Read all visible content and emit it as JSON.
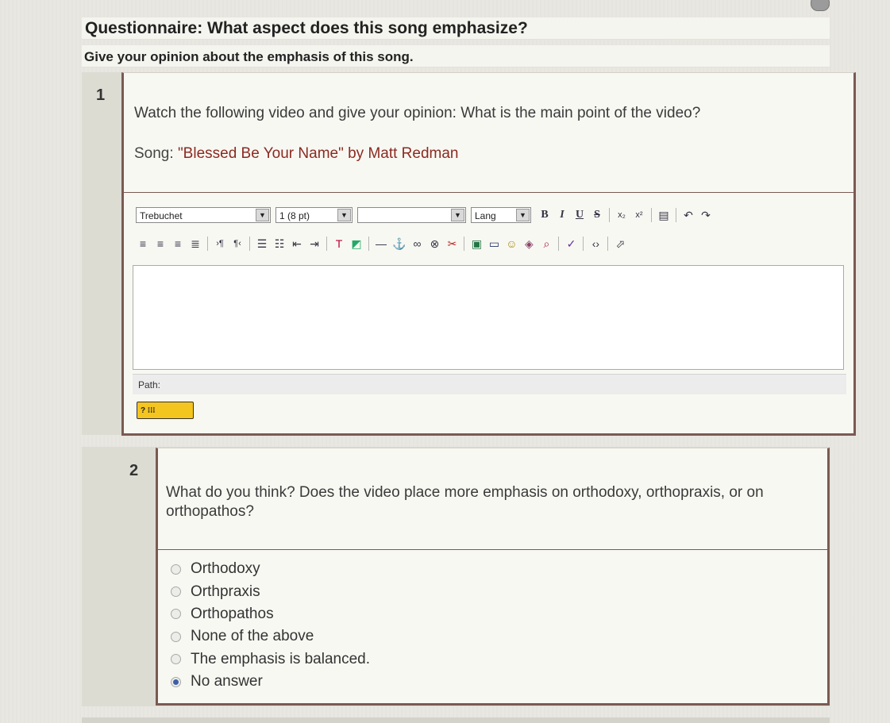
{
  "questionnaire": {
    "title": "Questionnaire: What aspect does this song emphasize?",
    "subtitle": "Give your opinion about the emphasis of this song."
  },
  "q1": {
    "number": "1",
    "text": "Watch the following video and give your opinion: What is the main point of the video?",
    "song_prefix": "Song: ",
    "song_title": "\"Blessed Be Your Name\" by Matt Redman",
    "editor": {
      "font_select": "Trebuchet",
      "size_select": "1 (8 pt)",
      "style_select": "",
      "lang_select": "Lang",
      "path_label": "Path:",
      "help_button_label": "?"
    }
  },
  "q2": {
    "number": "2",
    "text": "What do you think? Does the video place more emphasis on orthodoxy, orthopraxis, or on orthopathos?",
    "options": [
      "Orthodoxy",
      "Orthpraxis",
      "Orthopathos",
      "None of the above",
      "The emphasis is balanced.",
      "No answer"
    ],
    "selected_option": "No answer"
  },
  "icons": {
    "row1": [
      "bold-icon",
      "italic-icon",
      "underline-icon",
      "strikethrough-icon",
      "subscript-icon",
      "superscript-icon",
      "paste-icon",
      "undo-icon",
      "redo-icon"
    ],
    "row2": [
      "align-left-icon",
      "align-center-icon",
      "align-right-icon",
      "justify-icon",
      "ltr-icon",
      "rtl-icon",
      "ordered-list-icon",
      "unordered-list-icon",
      "outdent-icon",
      "indent-icon",
      "text-color-icon",
      "background-color-icon",
      "horizontal-rule-icon",
      "anchor-icon",
      "link-icon",
      "unlink-icon",
      "prevent-link-icon",
      "insert-image-icon",
      "insert-table-icon",
      "smiley-icon",
      "insert-char-icon",
      "search-replace-icon",
      "spellcheck-icon",
      "html-source-icon",
      "fullscreen-icon"
    ]
  },
  "colors": {
    "accent_border": "#7a5a52",
    "song_title": "#8b2a20",
    "help_button": "#f4c51f"
  }
}
